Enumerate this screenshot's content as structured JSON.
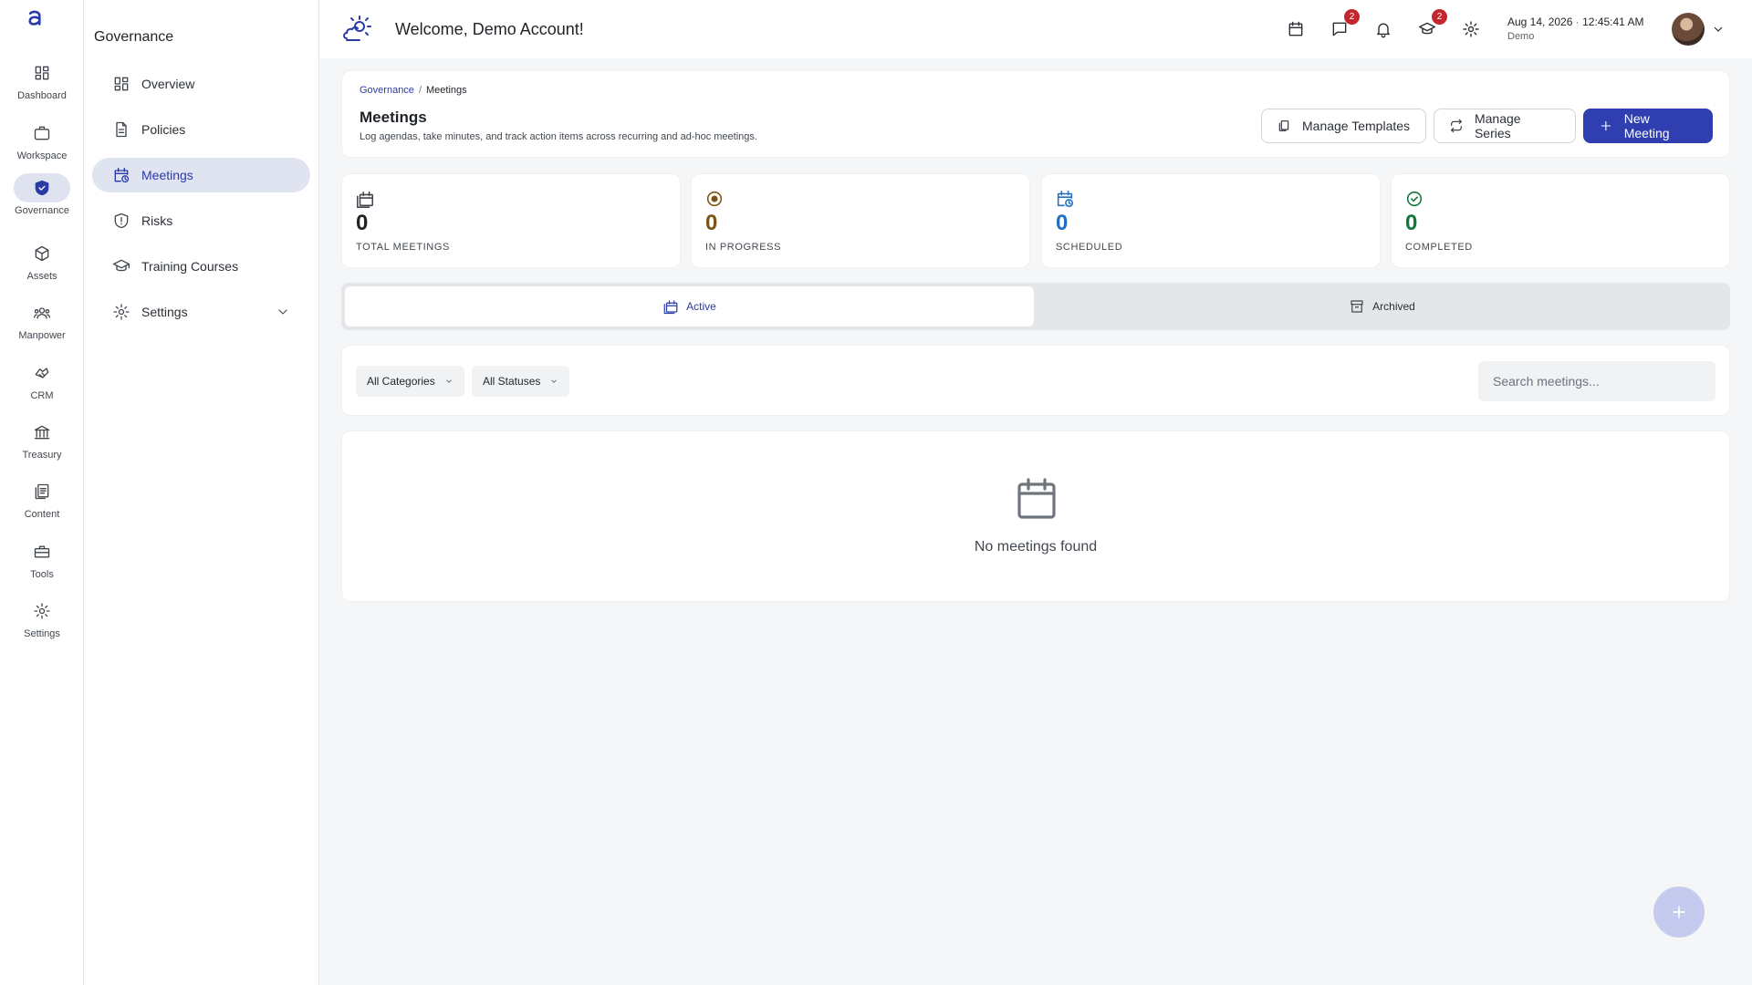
{
  "rail": {
    "items": [
      {
        "label": "Dashboard",
        "icon": "dashboard-icon"
      },
      {
        "label": "Workspace",
        "icon": "briefcase-icon"
      },
      {
        "label": "Governance",
        "icon": "shield-icon",
        "active": true
      },
      {
        "label": "Assets",
        "icon": "cube-icon"
      },
      {
        "label": "Manpower",
        "icon": "people-icon"
      },
      {
        "label": "CRM",
        "icon": "handshake-icon"
      },
      {
        "label": "Treasury",
        "icon": "bank-icon"
      },
      {
        "label": "Content",
        "icon": "documents-icon"
      },
      {
        "label": "Tools",
        "icon": "toolbox-icon"
      },
      {
        "label": "Settings",
        "icon": "gear-icon"
      }
    ]
  },
  "secnav": {
    "title": "Governance",
    "items": [
      {
        "label": "Overview",
        "icon": "grid-icon"
      },
      {
        "label": "Policies",
        "icon": "document-icon"
      },
      {
        "label": "Meetings",
        "icon": "calendar-clock-icon",
        "active": true
      },
      {
        "label": "Risks",
        "icon": "shield-alert-icon"
      },
      {
        "label": "Training Courses",
        "icon": "graduation-cap-icon"
      },
      {
        "label": "Settings",
        "icon": "gear-icon",
        "expandable": true
      }
    ]
  },
  "topbar": {
    "welcome": "Welcome, Demo Account!",
    "date": "Aug 14, 2026",
    "time": "12:45:41 AM",
    "date_separator": "·",
    "user_role": "Demo",
    "messages_badge": "2",
    "training_badge": "2"
  },
  "header": {
    "breadcrumb_parent": "Governance",
    "breadcrumb_sep": "/",
    "breadcrumb_current": "Meetings",
    "title": "Meetings",
    "subtitle": "Log agendas, take minutes, and track action items across recurring and ad-hoc meetings.",
    "manage_templates": "Manage Templates",
    "manage_series": "Manage Series",
    "new_meeting": "New Meeting"
  },
  "stats": [
    {
      "value": "0",
      "label": "TOTAL MEETINGS",
      "color": "#1f2328",
      "icon": "calendar-stack-icon"
    },
    {
      "value": "0",
      "label": "IN PROGRESS",
      "color": "#7a5410",
      "icon": "target-icon"
    },
    {
      "value": "0",
      "label": "SCHEDULED",
      "color": "#1f6fc5",
      "icon": "calendar-clock-icon"
    },
    {
      "value": "0",
      "label": "COMPLETED",
      "color": "#11783c",
      "icon": "check-circle-icon"
    }
  ],
  "tabs": {
    "active": "Active",
    "archived": "Archived"
  },
  "filters": {
    "category": "All Categories",
    "status": "All Statuses",
    "search_placeholder": "Search meetings..."
  },
  "empty": {
    "message": "No meetings found"
  },
  "colors": {
    "accent": "#2f3fb0",
    "badge": "#c4262e"
  }
}
